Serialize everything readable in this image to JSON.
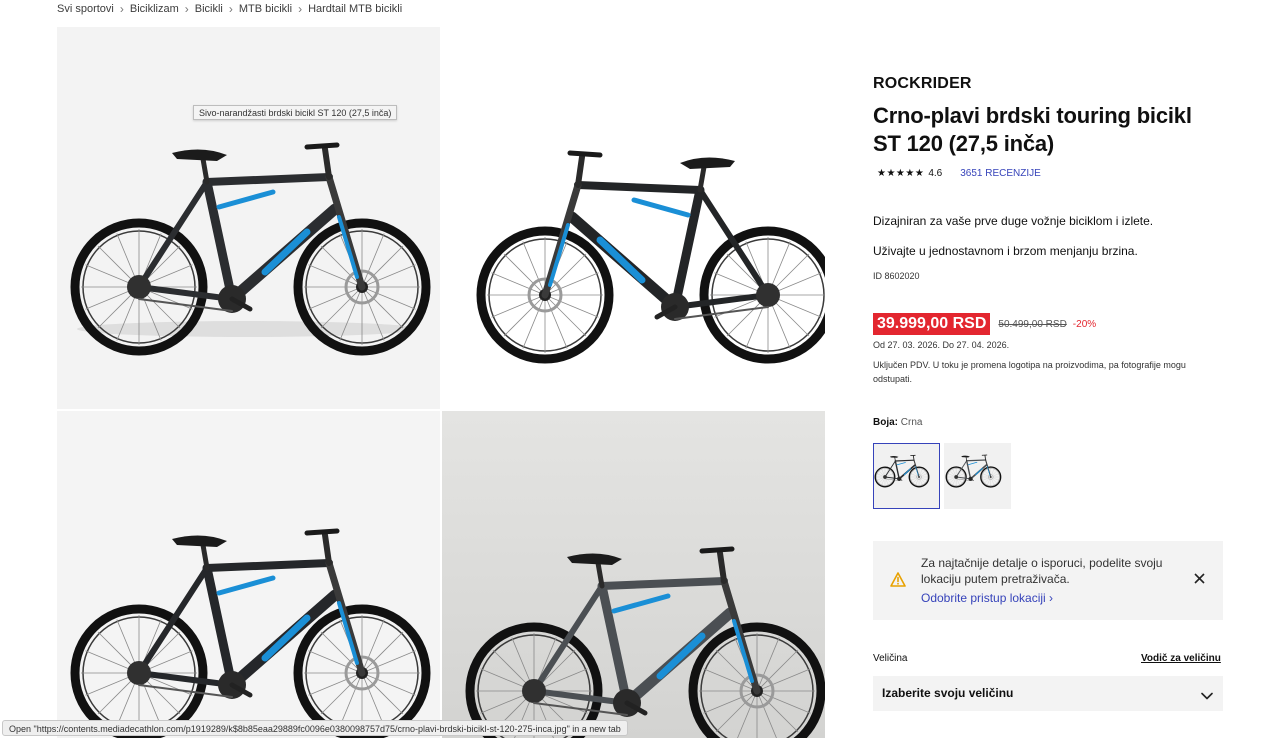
{
  "breadcrumb": [
    "Svi sportovi",
    "Biciklizam",
    "Bicikli",
    "MTB bicikli",
    "Hardtail MTB bicikli"
  ],
  "gallery": {
    "tooltip": "Sivo-narandžasti brdski bicikl ST 120 (27,5 inča)",
    "frame_colors": [
      "#2b2d30",
      "#232527",
      "#25272a",
      "#4b4f53"
    ],
    "accent_color": "#1a8fd6"
  },
  "statusbar": {
    "text": "Open \"https://contents.mediadecathlon.com/p1919289/k$8b85eaa29889fc0096e0380098757d75/crno-plavi-brdski-bicikl-st-120-275-inca.jpg\" in a new tab"
  },
  "product": {
    "brand": "ROCKRIDER",
    "title": "Crno-plavi brdski touring bicikl ST 120 (27,5 inča)",
    "stars": "★★★★★",
    "rating": "4.6",
    "reviews": "3651 RECENZIJE",
    "description": [
      "Dizajniran za vaše prve duge vožnje biciklom i izlete.",
      "Uživajte u jednostavnom i brzom menjanju brzina."
    ],
    "id": "ID 8602020"
  },
  "price": {
    "current": "39.999,00 RSD",
    "old": "50.499,00 RSD",
    "discount": "-20%",
    "dates": "Od 27. 03. 2026. Do 27. 04. 2026.",
    "vat_note": "Uključen PDV. U toku je promena logotipa na proizvodima, pa fotografije mogu odstupati."
  },
  "color": {
    "label": "Boja:",
    "value": "Crna"
  },
  "notice": {
    "text": "Za najtačnije detalje o isporuci, podelite svoju lokaciju putem pretraživača.",
    "link": "Odobrite pristup lokaciji ›"
  },
  "size": {
    "label": "Veličina",
    "guide": "Vodič za veličinu",
    "placeholder": "Izaberite svoju veličinu"
  },
  "colors": {
    "accent": "#3643ba",
    "sale": "#e3262f"
  }
}
